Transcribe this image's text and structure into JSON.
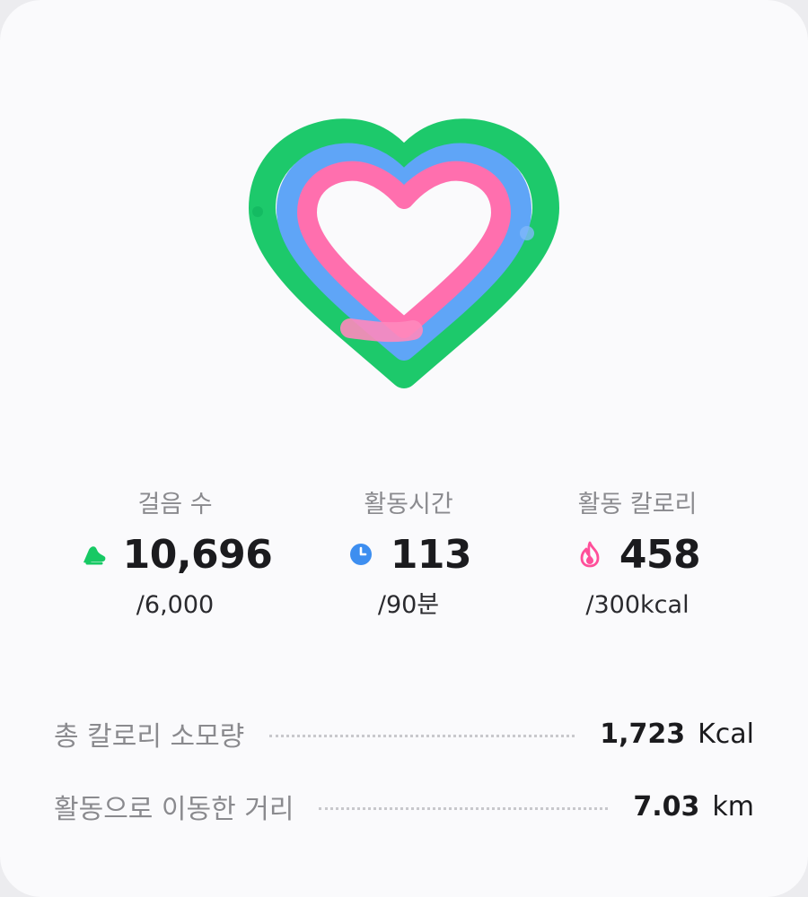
{
  "activity_rings": {
    "steps_color": "#17c964",
    "time_color": "#5aa2f5",
    "calories_color": "#ff6fae"
  },
  "stats": [
    {
      "label": "걸음 수",
      "value": "10,696",
      "goal": "/6,000",
      "icon": "shoe-icon",
      "color": "#17c964"
    },
    {
      "label": "활동시간",
      "value": "113",
      "goal": "/90분",
      "icon": "clock-icon",
      "color": "#3d8ef0"
    },
    {
      "label": "활동 칼로리",
      "value": "458",
      "goal": "/300kcal",
      "icon": "flame-icon",
      "color": "#ff4f9a"
    }
  ],
  "summary": {
    "total_calories": {
      "label": "총 칼로리 소모량",
      "value": "1,723",
      "unit": "Kcal"
    },
    "distance": {
      "label": "활동으로 이동한 거리",
      "value": "7.03",
      "unit": "km"
    }
  }
}
